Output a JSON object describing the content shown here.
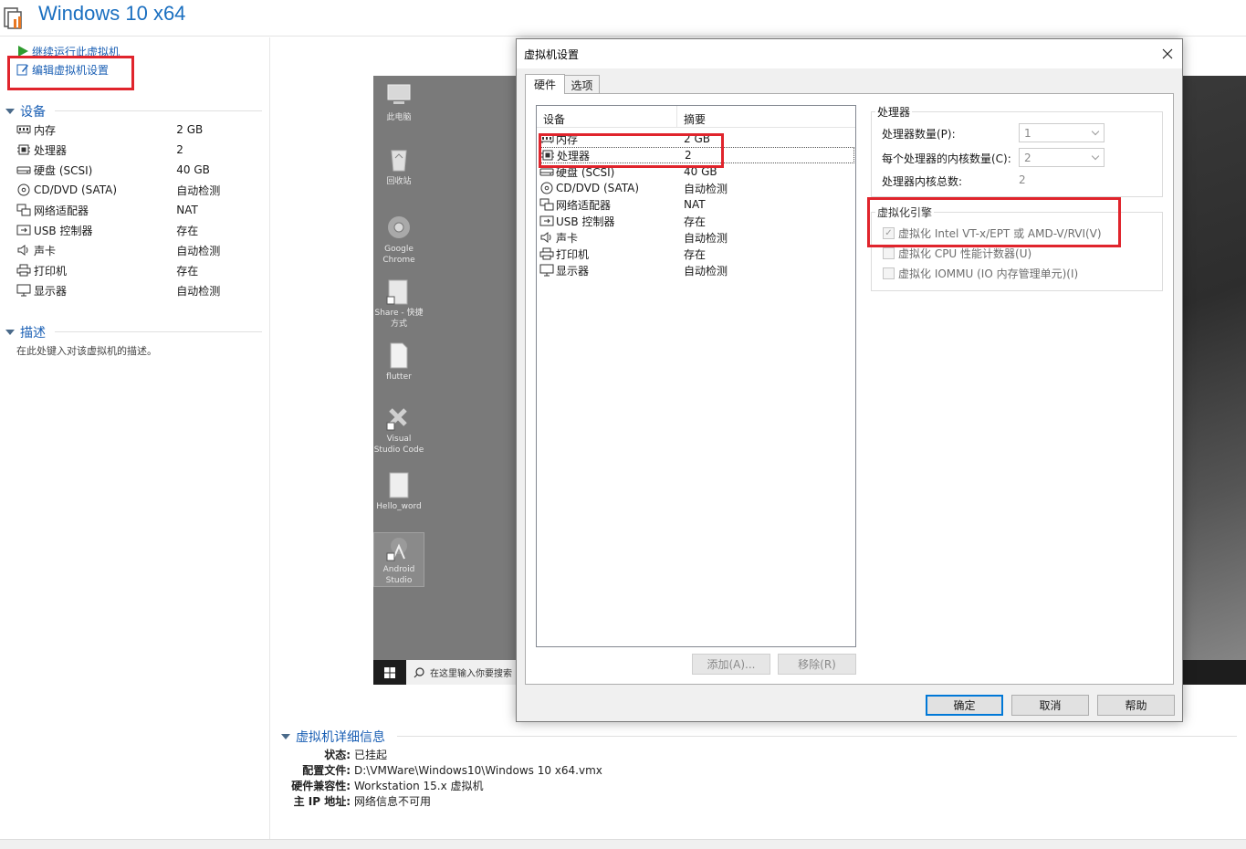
{
  "app": {
    "title": "Windows 10 x64"
  },
  "actions": {
    "resume": "继续运行此虚拟机",
    "edit": "编辑虚拟机设置"
  },
  "sidebar": {
    "devices_title": "设备",
    "devices": [
      {
        "name": "内存",
        "value": "2 GB",
        "icon": "memory-icon"
      },
      {
        "name": "处理器",
        "value": "2",
        "icon": "processor-icon"
      },
      {
        "name": "硬盘 (SCSI)",
        "value": "40 GB",
        "icon": "hard-disk-icon"
      },
      {
        "name": "CD/DVD (SATA)",
        "value": "自动检测",
        "icon": "cd-dvd-icon"
      },
      {
        "name": "网络适配器",
        "value": "NAT",
        "icon": "network-adapter-icon"
      },
      {
        "name": "USB 控制器",
        "value": "存在",
        "icon": "usb-icon"
      },
      {
        "name": "声卡",
        "value": "自动检测",
        "icon": "sound-card-icon"
      },
      {
        "name": "打印机",
        "value": "存在",
        "icon": "printer-icon"
      },
      {
        "name": "显示器",
        "value": "自动检测",
        "icon": "display-icon"
      }
    ],
    "description_title": "描述",
    "description_placeholder": "在此处键入对该虚拟机的描述。"
  },
  "desktop": {
    "icons": [
      {
        "label": "此电脑",
        "icon": "this-pc-icon"
      },
      {
        "label": "回收站",
        "icon": "recycle-bin-icon"
      },
      {
        "label": "Google Chrome",
        "icon": "chrome-icon"
      },
      {
        "label": "Share - 快捷方式",
        "icon": "folder-shortcut-icon"
      },
      {
        "label": "flutter",
        "icon": "file-icon"
      },
      {
        "label": "Visual Studio Code",
        "icon": "vscode-icon"
      },
      {
        "label": "Hello_word",
        "icon": "folder-icon"
      },
      {
        "label": "Android Studio",
        "icon": "android-studio-icon"
      }
    ],
    "search_placeholder": "在这里输入你要搜索"
  },
  "details": {
    "title": "虚拟机详细信息",
    "rows": [
      {
        "key": "状态:",
        "value": "已挂起"
      },
      {
        "key": "配置文件:",
        "value": "D:\\VMWare\\Windows10\\Windows 10 x64.vmx"
      },
      {
        "key": "硬件兼容性:",
        "value": "Workstation 15.x 虚拟机"
      },
      {
        "key": "主 IP 地址:",
        "value": "网络信息不可用"
      }
    ]
  },
  "dialog": {
    "title": "虚拟机设置",
    "tabs": [
      "硬件",
      "选项"
    ],
    "list_headers": {
      "device": "设备",
      "summary": "摘要"
    },
    "devices": [
      {
        "name": "内存",
        "value": "2 GB",
        "icon": "memory-icon"
      },
      {
        "name": "处理器",
        "value": "2",
        "icon": "processor-icon",
        "selected": true
      },
      {
        "name": "硬盘 (SCSI)",
        "value": "40 GB",
        "icon": "hard-disk-icon"
      },
      {
        "name": "CD/DVD (SATA)",
        "value": "自动检测",
        "icon": "cd-dvd-icon"
      },
      {
        "name": "网络适配器",
        "value": "NAT",
        "icon": "network-adapter-icon"
      },
      {
        "name": "USB 控制器",
        "value": "存在",
        "icon": "usb-icon"
      },
      {
        "name": "声卡",
        "value": "自动检测",
        "icon": "sound-card-icon"
      },
      {
        "name": "打印机",
        "value": "存在",
        "icon": "printer-icon"
      },
      {
        "name": "显示器",
        "value": "自动检测",
        "icon": "display-icon"
      }
    ],
    "add_button": "添加(A)...",
    "remove_button": "移除(R)",
    "processor": {
      "title": "处理器",
      "count_label": "处理器数量(P):",
      "count_value": "1",
      "cores_label": "每个处理器的内核数量(C):",
      "cores_value": "2",
      "total_label": "处理器内核总数:",
      "total_value": "2"
    },
    "virtualization": {
      "title": "虚拟化引擎",
      "options": [
        {
          "label": "虚拟化 Intel VT-x/EPT 或 AMD-V/RVI(V)",
          "checked": true
        },
        {
          "label": "虚拟化 CPU 性能计数器(U)",
          "checked": false
        },
        {
          "label": "虚拟化 IOMMU (IO 内存管理单元)(I)",
          "checked": false
        }
      ]
    },
    "ok_button": "确定",
    "cancel_button": "取消",
    "help_button": "帮助"
  },
  "colors": {
    "accent": "#1a5fb4",
    "title": "#1a6fc0",
    "highlight": "#e0242c"
  }
}
